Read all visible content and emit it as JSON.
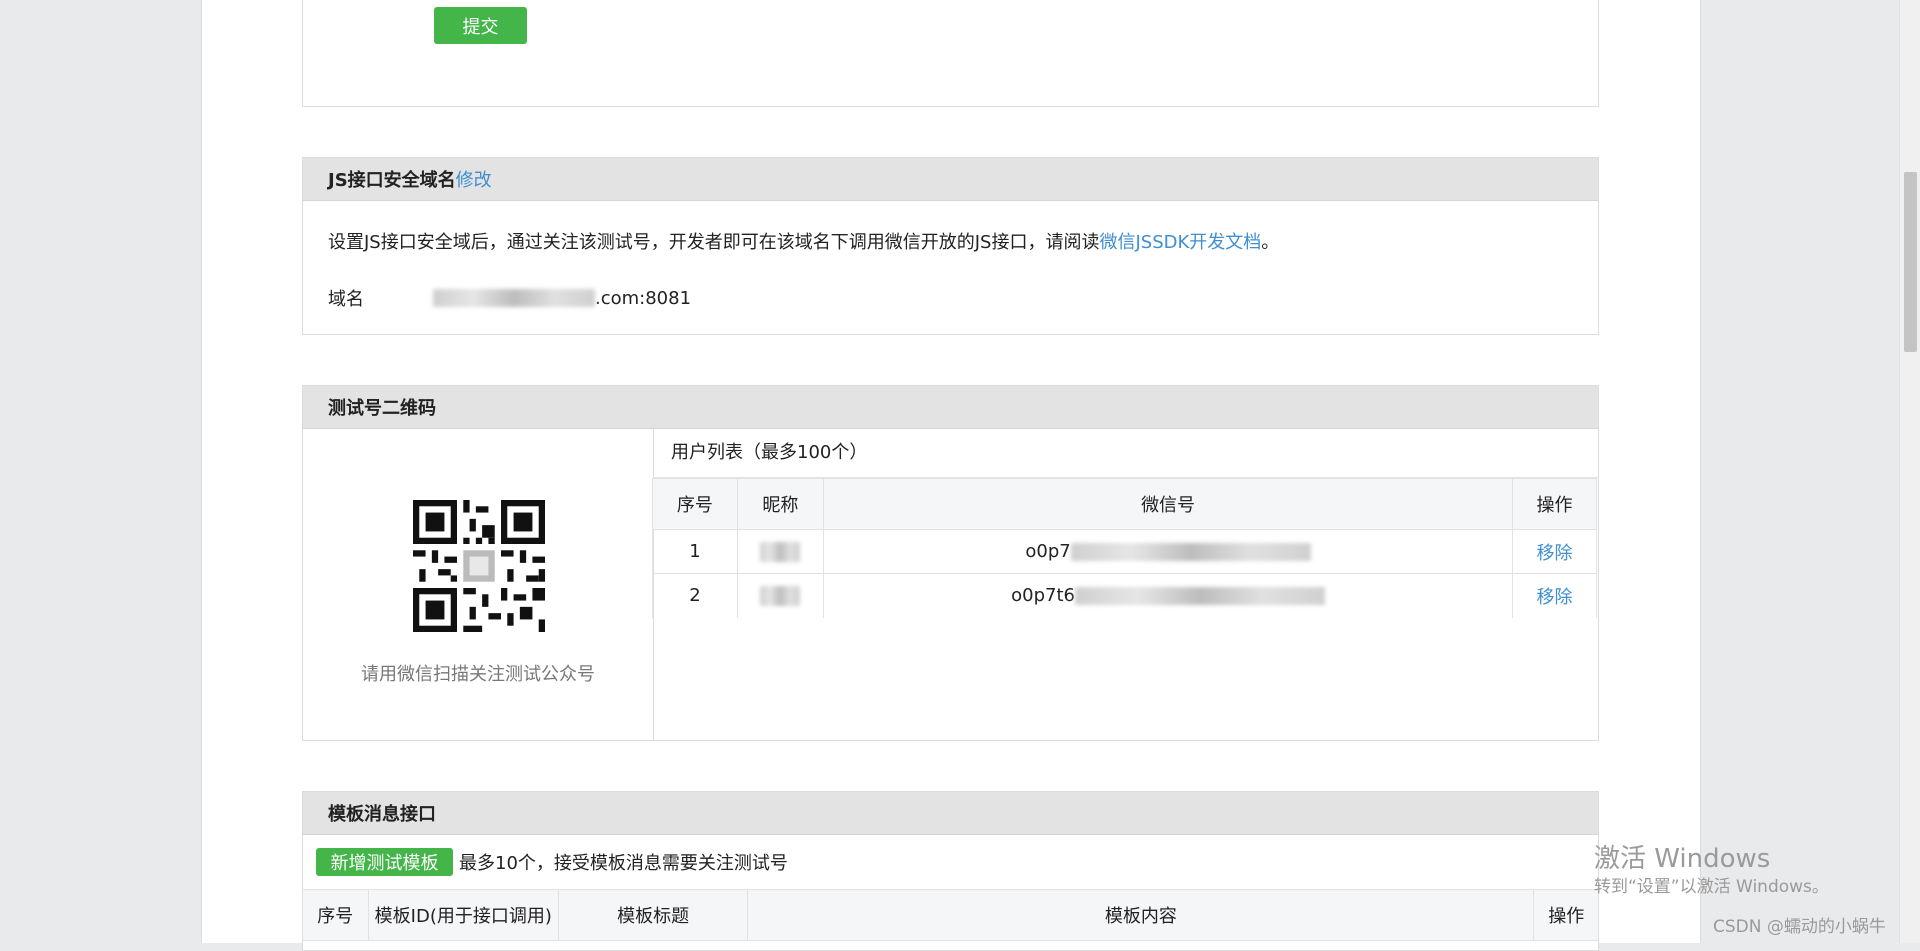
{
  "submit_panel": {
    "submit_label": "提交"
  },
  "js_domain": {
    "title": "JS接口安全域名",
    "edit_label": "修改",
    "desc_prefix": "设置JS接口安全域后，通过关注该测试号，开发者即可在该域名下调用微信开放的JS接口，请阅读",
    "doc_link": "微信JSSDK开发文档",
    "desc_suffix": "。",
    "domain_label": "域名",
    "domain_suffix": ".com:8081"
  },
  "qr_panel": {
    "title": "测试号二维码",
    "qr_caption": "请用微信扫描关注测试公众号",
    "user_list_title": "用户列表（最多100个）",
    "columns": [
      "序号",
      "昵称",
      "微信号",
      "操作"
    ],
    "rows": [
      {
        "index": "1",
        "wechat_prefix": "o0p7",
        "action": "移除"
      },
      {
        "index": "2",
        "wechat_prefix": "o0p7t6",
        "action": "移除"
      }
    ]
  },
  "template_panel": {
    "title": "模板消息接口",
    "add_button": "新增测试模板",
    "note": "最多10个，接受模板消息需要关注测试号",
    "columns": [
      "序号",
      "模板ID(用于接口调用)",
      "模板标题",
      "模板内容",
      "操作"
    ]
  },
  "overlay": {
    "activate_title": "激活 Windows",
    "activate_sub": "转到“设置”以激活 Windows。",
    "csdn": "CSDN @蠕动的小蜗牛"
  },
  "colors": {
    "link": "#3e8ed0",
    "green": "#44b549",
    "header_bg": "#e3e3e3"
  }
}
